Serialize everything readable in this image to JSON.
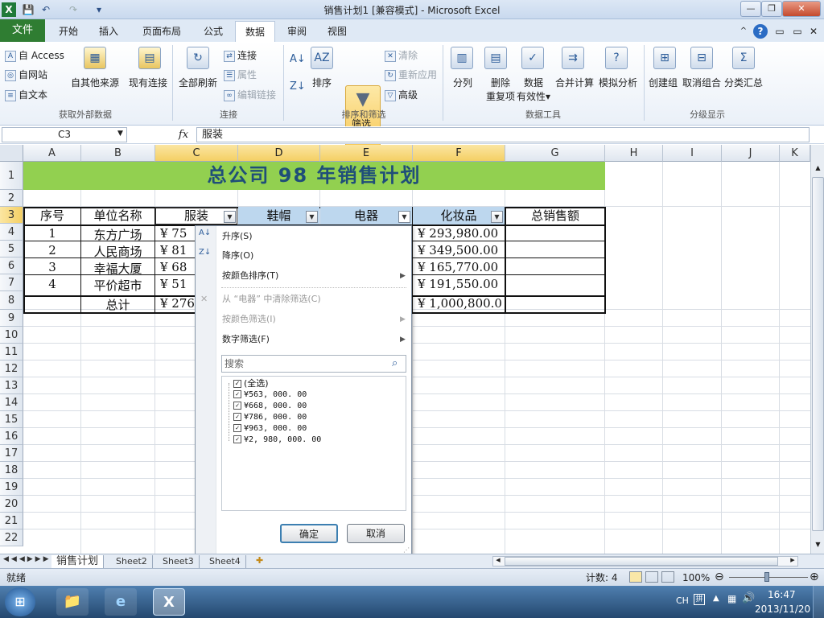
{
  "window": {
    "title": "销售计划1  [兼容模式]  -  Microsoft Excel",
    "app_icon": "X",
    "min": "—",
    "max": "❐",
    "close": "✕",
    "ribbon_min": "▭",
    "ribbon_max": "▭",
    "ribbon_close": "✕"
  },
  "qat": {
    "save": "💾",
    "undo": "↶",
    "redo": "↷",
    "customize": "▾"
  },
  "tabs": {
    "file": "文件",
    "home": "开始",
    "insert": "插入",
    "layout": "页面布局",
    "formulas": "公式",
    "data": "数据",
    "review": "审阅",
    "view": "视图"
  },
  "ribbon": {
    "ext": {
      "access": "自 Access",
      "web": "自网站",
      "text": "自文本",
      "other": "自其他来源",
      "existing": "现有连接",
      "label": "获取外部数据"
    },
    "conn": {
      "refresh": "全部刷新",
      "connections": "连接",
      "properties": "属性",
      "edit_links": "编辑链接",
      "label": "连接"
    },
    "sort": {
      "sort": "排序",
      "filter": "筛选",
      "clear": "清除",
      "reapply": "重新应用",
      "advanced": "高级",
      "label": "排序和筛选"
    },
    "tools": {
      "split": "分列",
      "dedupe_1": "删除",
      "dedupe_2": "重复项",
      "valid_1": "数据",
      "valid_2": "有效性",
      "consolidate": "合并计算",
      "whatif": "模拟分析",
      "label": "数据工具"
    },
    "outline": {
      "group": "创建组",
      "ungroup": "取消组合",
      "subtotal": "分类汇总",
      "label": "分级显示"
    }
  },
  "formula": {
    "cell_ref": "C3",
    "fx": "fx",
    "value": "服装"
  },
  "columns": [
    "A",
    "B",
    "C",
    "D",
    "E",
    "F",
    "G",
    "H",
    "I",
    "J",
    "K"
  ],
  "rows": [
    "1",
    "2",
    "3",
    "4",
    "5",
    "6",
    "7",
    "8",
    "9",
    "10",
    "11",
    "12",
    "13",
    "14",
    "15",
    "16",
    "17",
    "18",
    "19",
    "20",
    "21",
    "22"
  ],
  "sheet": {
    "banner": "总公司 98 年销售计划",
    "headers": {
      "no": "序号",
      "unit": "单位名称",
      "clothing": "服装",
      "hats": "鞋帽",
      "appliance": "电器",
      "cosmetics": "化妆品",
      "total": "总销售额"
    },
    "rows": [
      {
        "no": "1",
        "unit": "东方广场",
        "c": "¥   75",
        "f": "¥     293,980.00"
      },
      {
        "no": "2",
        "unit": "人民商场",
        "c": "¥   81",
        "f": "¥     349,500.00"
      },
      {
        "no": "3",
        "unit": "幸福大厦",
        "c": "¥   68",
        "f": "¥     165,770.00"
      },
      {
        "no": "4",
        "unit": "平价超市",
        "c": "¥   51",
        "f": "¥     191,550.00"
      }
    ],
    "total_label": "总计",
    "total_c": "¥  276",
    "total_f": "¥  1,000,800.00"
  },
  "dropdown": {
    "asc": "升序(S)",
    "desc": "降序(O)",
    "color_sort": "按颜色排序(T)",
    "clear": "从 “电器” 中清除筛选(C)",
    "color_filter": "按颜色筛选(I)",
    "num_filter": "数字筛选(F)",
    "search_placeholder": "搜索",
    "items": [
      "(全选)",
      "¥563, 000. 00",
      "¥668, 000. 00",
      "¥786, 000. 00",
      "¥963, 000. 00",
      "¥2, 980, 000. 00"
    ],
    "ok": "确定",
    "cancel": "取消"
  },
  "sheettabs": [
    "销售计划",
    "Sheet2",
    "Sheet3",
    "Sheet4"
  ],
  "status": {
    "ready": "就绪",
    "count": "计数: 4",
    "zoom": "100%"
  },
  "taskbar": {
    "lang": "CH",
    "time": "16:47",
    "date": "2013/11/20"
  }
}
